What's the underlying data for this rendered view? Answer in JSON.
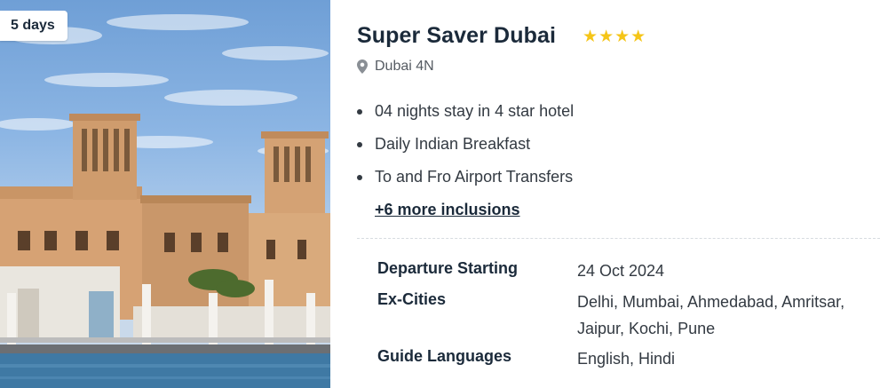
{
  "package": {
    "duration_badge": "5 days",
    "title": "Super Saver Dubai",
    "rating_stars": 4,
    "location": "Dubai 4N",
    "inclusions": [
      "04 nights stay in 4 star hotel",
      "Daily Indian Breakfast",
      "To and Fro Airport Transfers"
    ],
    "more_inclusions": "+6 more inclusions"
  },
  "details": {
    "departure_label": "Departure Starting",
    "departure_value": "24 Oct 2024",
    "excities_label": "Ex-Cities",
    "excities_value": "Delhi, Mumbai, Ahmedabad, Amritsar, Jaipur, Kochi, Pune",
    "guide_label": "Guide Languages",
    "guide_value": "English, Hindi"
  },
  "colors": {
    "star": "#f5c518",
    "title": "#1b2a3a",
    "body_text": "#333a42"
  },
  "icons": {
    "location": "map-pin-icon",
    "star": "star-icon"
  }
}
